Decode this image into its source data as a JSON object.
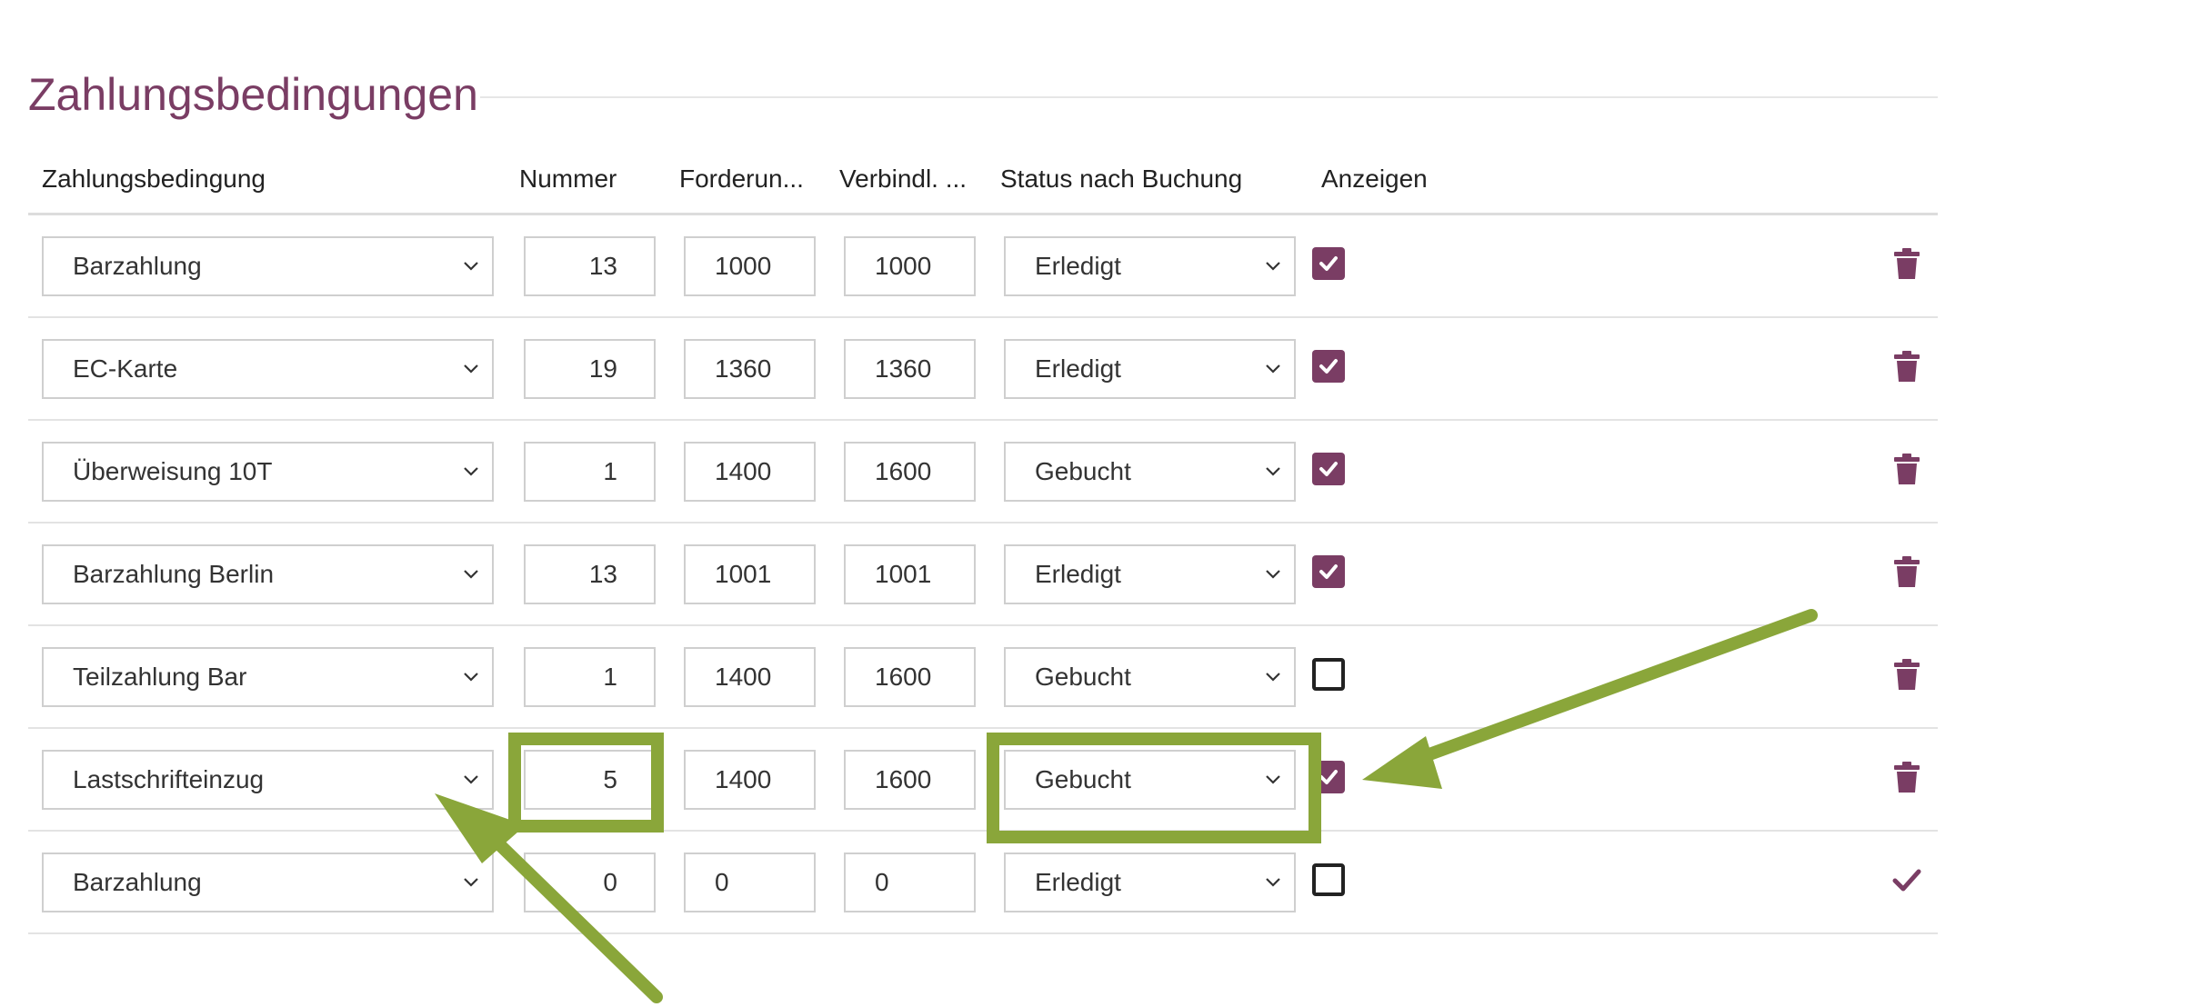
{
  "section": {
    "title": "Zahlungsbedingungen"
  },
  "columns": {
    "zahlungsbedingung": "Zahlungsbedingung",
    "nummer": "Nummer",
    "forderung": "Forderun...",
    "verbindl": "Verbindl. ...",
    "status": "Status nach Buchung",
    "anzeigen": "Anzeigen"
  },
  "rows": [
    {
      "bedingung": "Barzahlung",
      "nummer": "13",
      "forderung": "1000",
      "verbindl": "1000",
      "status": "Erledigt",
      "anzeigen": true,
      "action": "trash-icon"
    },
    {
      "bedingung": "EC-Karte",
      "nummer": "19",
      "forderung": "1360",
      "verbindl": "1360",
      "status": "Erledigt",
      "anzeigen": true,
      "action": "trash-icon"
    },
    {
      "bedingung": "Überweisung 10T",
      "nummer": "1",
      "forderung": "1400",
      "verbindl": "1600",
      "status": "Gebucht",
      "anzeigen": true,
      "action": "trash-icon"
    },
    {
      "bedingung": "Barzahlung Berlin",
      "nummer": "13",
      "forderung": "1001",
      "verbindl": "1001",
      "status": "Erledigt",
      "anzeigen": true,
      "action": "trash-icon"
    },
    {
      "bedingung": "Teilzahlung Bar",
      "nummer": "1",
      "forderung": "1400",
      "verbindl": "1600",
      "status": "Gebucht",
      "anzeigen": false,
      "action": "trash-icon"
    },
    {
      "bedingung": "Lastschrifteinzug",
      "nummer": "5",
      "forderung": "1400",
      "verbindl": "1600",
      "status": "Gebucht",
      "anzeigen": true,
      "action": "trash-icon"
    },
    {
      "bedingung": "Barzahlung",
      "nummer": "0",
      "forderung": "0",
      "verbindl": "0",
      "status": "Erledigt",
      "anzeigen": false,
      "action": "checkmark-icon"
    }
  ],
  "colors": {
    "accent": "#7a3d64",
    "annotation": "#8aa63a"
  }
}
